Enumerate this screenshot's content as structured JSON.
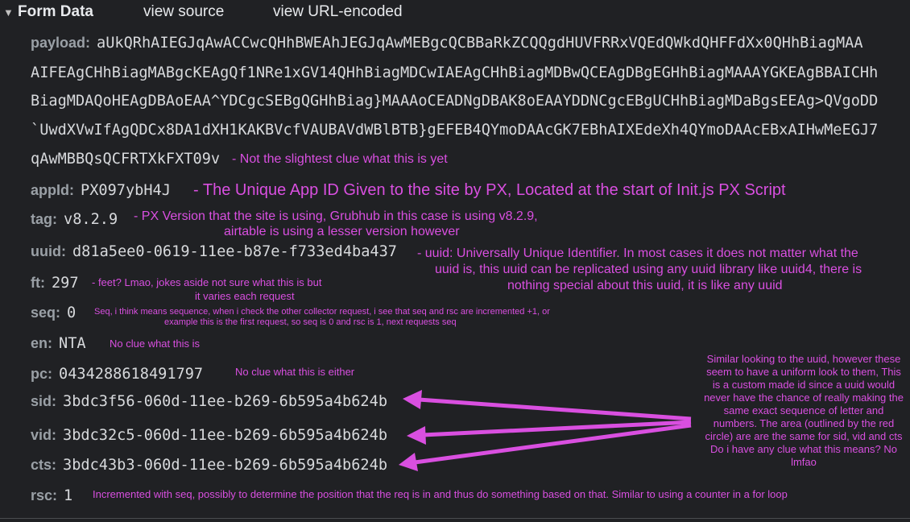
{
  "header": {
    "toggle_icon": "triangle-down-icon",
    "title": "Form Data",
    "view_source": "view source",
    "view_url_encoded": "view URL-encoded"
  },
  "payload": {
    "label": "payload:",
    "lines": [
      "aUkQRhAIEGJqAwACCwcQHhBWEAhJEGJqAwMEBgcQCBBaRkZCQQgdHUVFRRxVQEdQWkdQHFFdXx0QHhBiagMAA",
      "AIFEAgCHhBiagMABgcKEAgQf1NRe1xGV14QHhBiagMDCwIAEAgCHhBiagMDBwQCEAgDBgEGHhBiagMAAAYGKEAgBBAICHh",
      "BiagMDAQoHEAgDBAoEAA^YDCgcSEBgQGHhBiag}MAAAoCEADNgDBAK8oEAAYDDNCgcEBgUCHhBiagMDaBgsEEAg>QVgoDD",
      "`UwdXVwIfAgQDCx8DA1dXH1KAKBVcfVAUBAVdWBlBTB}gEFEB4QYmoDAAcGK7EBhAIXEdeXh4QYmoDAAcEBxAIHwMeEGJ7",
      "qAwMBBQsQCFRTXkFXT09v"
    ],
    "note": "- Not the slightest clue what this is yet"
  },
  "fields": {
    "appId": {
      "label": "appId:",
      "value": "PX097ybH4J",
      "note": "- The Unique App ID Given to the site by PX, Located at the start of Init.js PX Script"
    },
    "tag": {
      "label": "tag:",
      "value": "v8.2.9",
      "note1": "- PX Version that the site is using, Grubhub in this case is using v8.2.9,",
      "note2": "airtable is using a lesser version however"
    },
    "uuid": {
      "label": "uuid:",
      "value": "d81a5ee0-0619-11ee-b87e-f733ed4ba437",
      "note1": "- uuid:  Universally Unique Identifier. In most cases it does not matter what the",
      "note2": "uuid is, this uuid can be replicated using any uuid library like uuid4, there is",
      "note3": "nothing special about this uuid, it is like any uuid"
    },
    "ft": {
      "label": "ft:",
      "value": "297",
      "note1": "- feet? Lmao, jokes aside not sure what this is but",
      "note2": "it varies each request"
    },
    "seq": {
      "label": "seq:",
      "value": "0",
      "note1": "Seq, i think means sequence, when i check the other collector request, i see that seq and rsc are incremented +1, or",
      "note2": "example this is the first request,  so seq is 0 and rsc is 1, next requests seq"
    },
    "en": {
      "label": "en:",
      "value": "NTA",
      "note": "No clue what this is"
    },
    "pc": {
      "label": "pc:",
      "value": "0434288618491797",
      "note": "No clue what this is either"
    },
    "sid": {
      "label": "sid:",
      "value": "3bdc3f56-060d-11ee-b269-6b595a4b624b"
    },
    "vid": {
      "label": "vid:",
      "value": "3bdc32c5-060d-11ee-b269-6b595a4b624b"
    },
    "cts": {
      "label": "cts:",
      "value": "3bdc43b3-060d-11ee-b269-6b595a4b624b"
    },
    "rsc": {
      "label": "rsc:",
      "value": "1",
      "note": "Incremented with seq, possibly to determine the position that the req is in and thus do something based on that. Similar to using a counter in a for loop"
    }
  },
  "id_note": [
    "Similar looking to the uuid, however these",
    "seem to have a uniform look to them, This",
    "is a custom made id since a uuid would",
    "never have the chance of really making the",
    "same exact sequence of letter and",
    "numbers. The area (outlined by the red",
    "circle) are are the same for sid, vid and cts",
    "Do i have any clue what this means? No",
    "lmfao"
  ],
  "colors": {
    "annotation": "#d94fe0",
    "background": "#202124"
  }
}
